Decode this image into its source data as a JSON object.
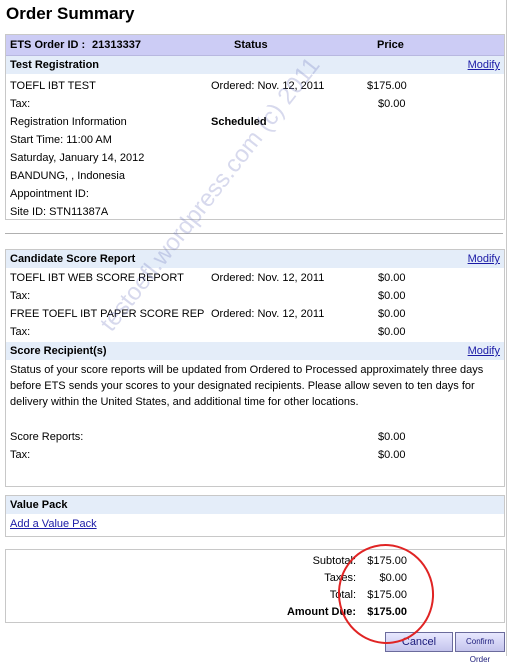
{
  "page": {
    "title": "Order Summary"
  },
  "order_header": {
    "order_id_label": "ETS Order ID :",
    "order_id": "21313337",
    "status_label": "Status",
    "price_label": "Price"
  },
  "test_registration": {
    "title": "Test Registration",
    "modify": "Modify",
    "item": "TOEFL IBT TEST",
    "item_status": "Ordered: Nov. 12, 2011",
    "item_price": "$175.00",
    "tax_label": "Tax:",
    "tax_price": "$0.00",
    "reg_info_label": "Registration Information",
    "reg_status": "Scheduled",
    "start_time": "Start Time:   11:00 AM",
    "date": "Saturday, January 14, 2012",
    "location": "BANDUNG, , Indonesia",
    "appointment": "Appointment ID:",
    "site": "Site ID:  STN11387A"
  },
  "score_report": {
    "title": "Candidate Score Report",
    "modify": "Modify",
    "item1": "TOEFL IBT WEB SCORE REPORT",
    "item1_status": "Ordered: Nov. 12, 2011",
    "item1_price": "$0.00",
    "tax1_label": "Tax:",
    "tax1_price": "$0.00",
    "item2": "FREE TOEFL IBT PAPER SCORE REP",
    "item2_status": "Ordered: Nov. 12, 2011",
    "item2_price": "$0.00",
    "tax2_label": "Tax:",
    "tax2_price": "$0.00"
  },
  "score_recipients": {
    "title": "Score Recipient(s)",
    "modify": "Modify",
    "notice_line1": "Status of your score reports will be updated from Ordered to Processed approximately three days",
    "notice_line2": "before ETS sends your scores to your designated recipients. Please allow seven to ten days for",
    "notice_line3": "delivery within the United States, and additional time for other locations.",
    "reports_label": "Score Reports:",
    "reports_price": "$0.00",
    "tax_label": "Tax:",
    "tax_price": "$0.00"
  },
  "value_pack": {
    "title": "Value Pack",
    "add_link": "Add a Value Pack"
  },
  "totals": {
    "subtotal_label": "Subtotal:",
    "subtotal": "$175.00",
    "taxes_label": "Taxes:",
    "taxes": "$0.00",
    "total_label": "Total:",
    "total": "$175.00",
    "amount_due_label": "Amount Due:",
    "amount_due": "$175.00"
  },
  "buttons": {
    "cancel": "Cancel",
    "confirm": "Confirm Order"
  },
  "watermark": "testoefl.wordpress.com (c) 2011",
  "colors": {
    "header_blue": "#ccccf5",
    "section_light": "#e4edf9",
    "link": "#1a1aa6",
    "annotation_red": "#e02424"
  }
}
